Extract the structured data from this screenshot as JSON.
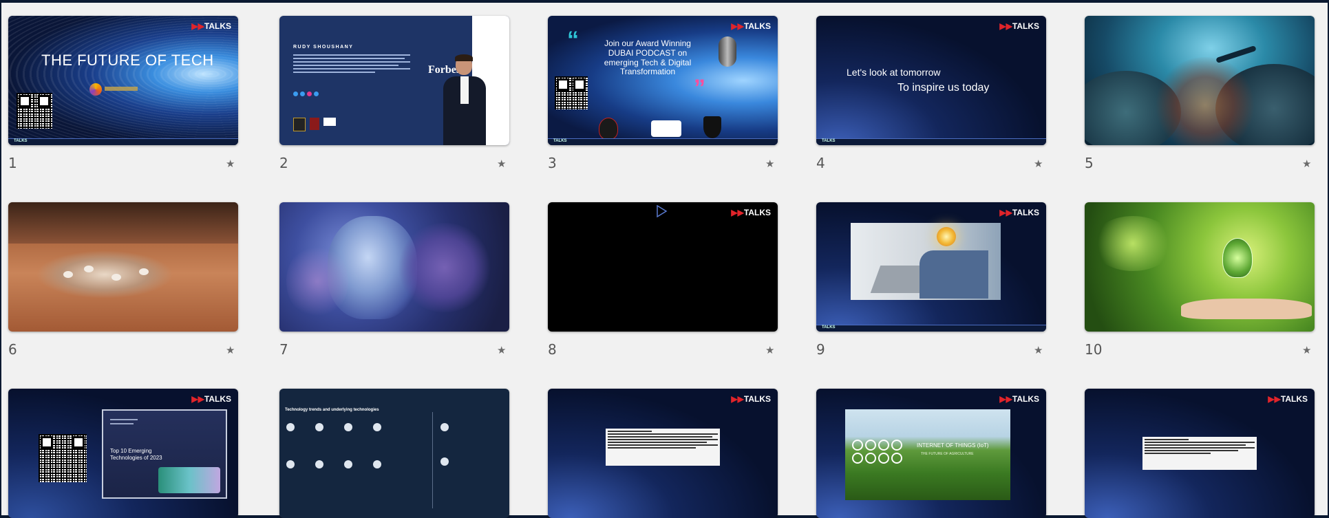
{
  "slides": [
    {
      "number": "1",
      "title": "THE FUTURE OF TECH"
    },
    {
      "number": "2",
      "speaker_name": "RUDY SHOUSHANY",
      "badge": "Forbes"
    },
    {
      "number": "3",
      "headline": "Join our Award Winning DUBAI PODCAST on emerging Tech & Digital Transformation"
    },
    {
      "number": "4",
      "line1": "Let's look at tomorrow",
      "line2": "To inspire us today"
    },
    {
      "number": "5"
    },
    {
      "number": "6"
    },
    {
      "number": "7"
    },
    {
      "number": "8"
    },
    {
      "number": "9"
    },
    {
      "number": "10"
    },
    {
      "number": "",
      "report_title": "Top 10 Emerging Technologies of 2023"
    },
    {
      "number": "",
      "heading": "Technology trends and underlying technologies"
    },
    {
      "number": ""
    },
    {
      "number": "",
      "heading": "INTERNET OF THINGS (IoT)",
      "subheading": "THE FUTURE OF AGRICULTURE"
    },
    {
      "number": ""
    }
  ],
  "brand": {
    "logo_accent": "▶▶",
    "logo_text": "TALKS"
  },
  "colors": {
    "background": "#0b1931",
    "panel": "#f1f1f1",
    "logo_red": "#e0242a"
  },
  "icons": {
    "star": "star-icon",
    "play": "play-icon"
  },
  "star_glyph": "★"
}
